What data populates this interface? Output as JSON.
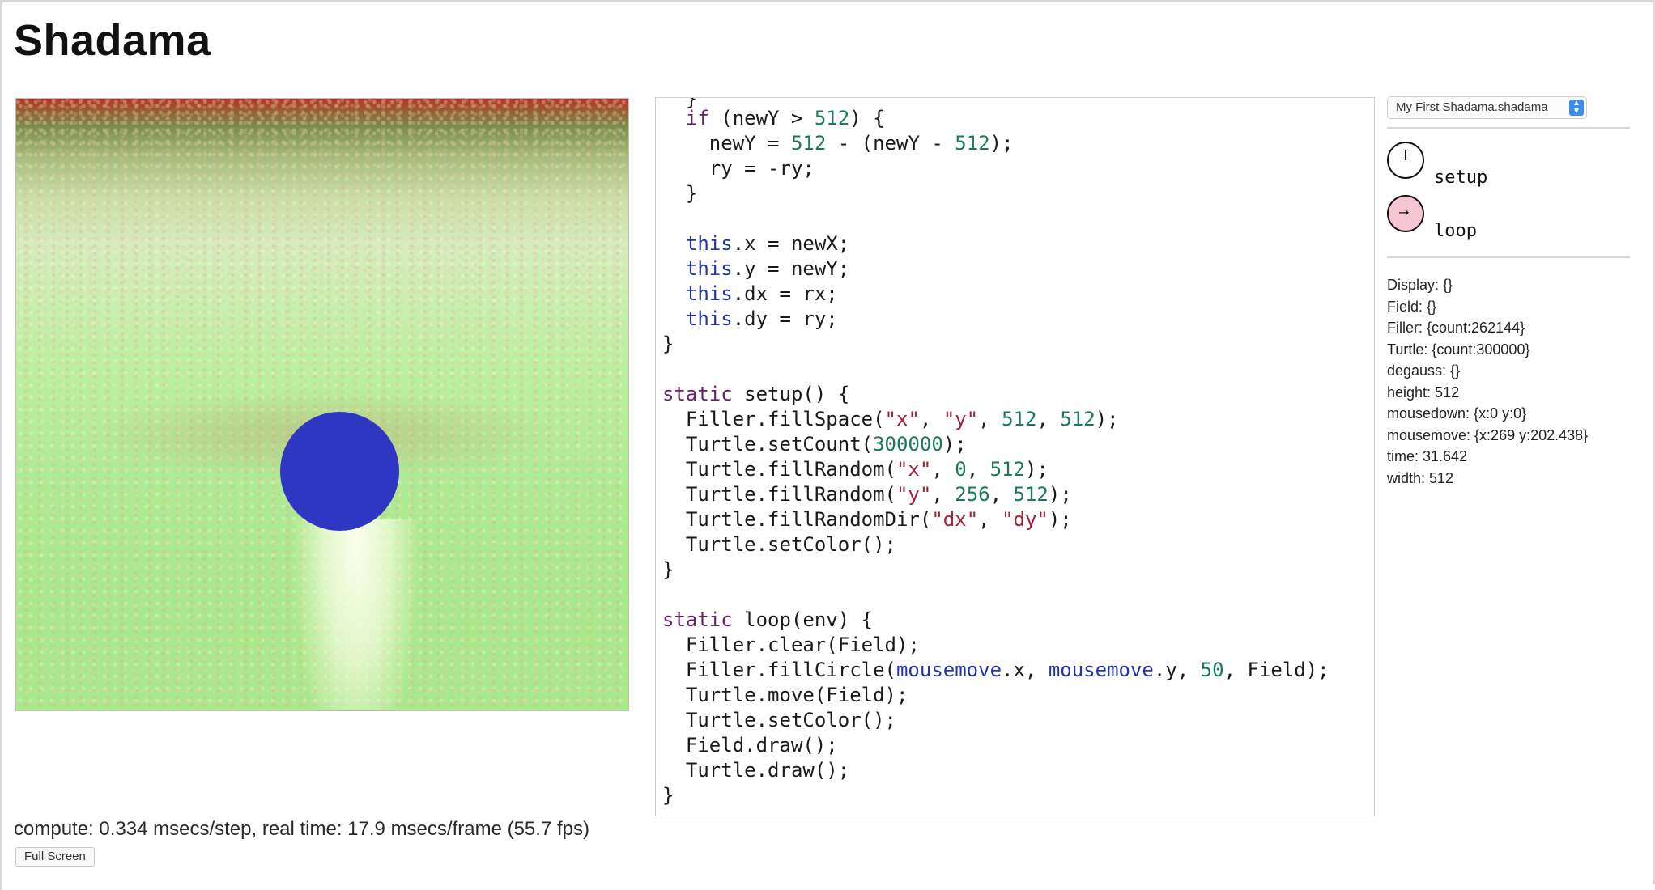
{
  "app": {
    "title": "Shadama"
  },
  "canvas": {
    "colors": {
      "circle": "#2f36c2",
      "field_green": "#a8e98b",
      "top_red": "#b8332b"
    }
  },
  "editor": {
    "lines": [
      "  if (newY > 512) {",
      "    newY = 512 - (newY - 512);",
      "    ry = -ry;",
      "  }",
      "",
      "  this.x = newX;",
      "  this.y = newY;",
      "  this.dx = rx;",
      "  this.dy = ry;",
      "}",
      "",
      "static setup() {",
      "  Filler.fillSpace(\"x\", \"y\", 512, 512);",
      "  Turtle.setCount(300000);",
      "  Turtle.fillRandom(\"x\", 0, 512);",
      "  Turtle.fillRandom(\"y\", 256, 512);",
      "  Turtle.fillRandomDir(\"dx\", \"dy\");",
      "  Turtle.setColor();",
      "}",
      "",
      "static loop(env) {",
      "  Filler.clear(Field);",
      "  Filler.fillCircle(mousemove.x, mousemove.y, 50, Field);",
      "  Turtle.move(Field);",
      "  Turtle.setColor();",
      "  Field.draw();",
      "  Turtle.draw();",
      "}"
    ]
  },
  "panel": {
    "file_select": "My First Shadama.shadama",
    "triggers": {
      "setup_label": "setup",
      "loop_label": "loop"
    },
    "env": [
      "Display: {}",
      "Field: {}",
      "Filler: {count:262144}",
      "Turtle: {count:300000}",
      "degauss: {}",
      "height: 512",
      "mousedown: {x:0 y:0}",
      "mousemove: {x:269 y:202.438}",
      "time: 31.642",
      "width: 512"
    ]
  },
  "status": {
    "text": "compute: 0.334 msecs/step, real time: 17.9 msecs/frame (55.7 fps)",
    "fullscreen_label": "Full Screen"
  }
}
